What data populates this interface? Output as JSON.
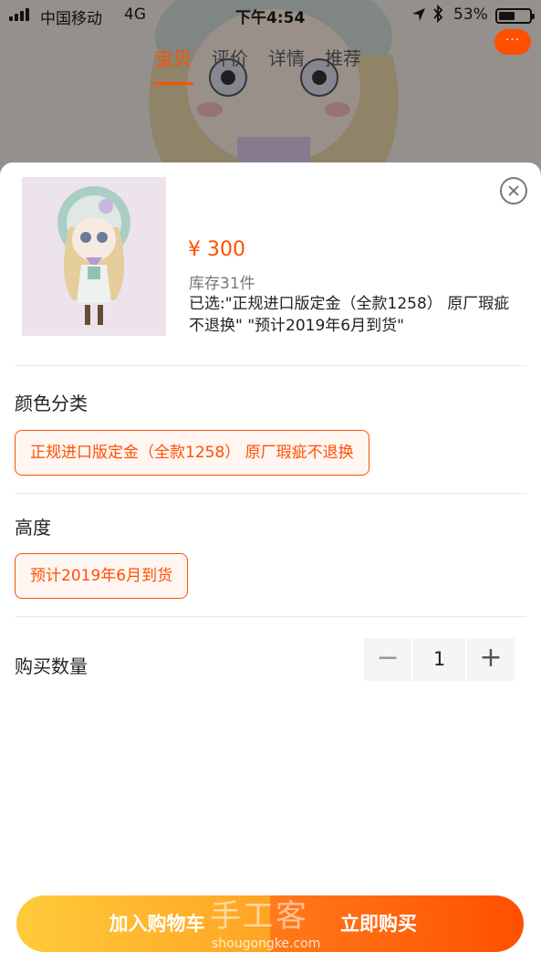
{
  "status_bar": {
    "carrier": "中国移动",
    "network": "4G",
    "time": "下午4:54",
    "battery": "53%"
  },
  "nav": {
    "tabs": [
      {
        "label": "宝贝",
        "active": true
      },
      {
        "label": "评价",
        "active": false
      },
      {
        "label": "详情",
        "active": false
      },
      {
        "label": "推荐",
        "active": false
      }
    ],
    "more_label": "···"
  },
  "product": {
    "price": "¥ 300",
    "stock": "库存31件",
    "selected": "已选:\"正规进口版定金（全款1258） 原厂瑕疵不退换\" \"预计2019年6月到货\""
  },
  "color_section": {
    "title": "颜色分类",
    "option": "正规进口版定金（全款1258） 原厂瑕疵不退换"
  },
  "height_section": {
    "title": "高度",
    "option": "预计2019年6月到货"
  },
  "quantity": {
    "label": "购买数量",
    "minus": "−",
    "value": "1",
    "plus": "+"
  },
  "actions": {
    "add_to_cart": "加入购物车",
    "buy_now": "立即购买"
  },
  "watermark": {
    "cn": "手工客",
    "en": "shougongke.com"
  },
  "colors": {
    "accent": "#ff5000",
    "cart_gradient": [
      "#ffcb3a",
      "#ffa423"
    ],
    "buy_gradient": [
      "#ff7a1a",
      "#ff5000"
    ]
  }
}
